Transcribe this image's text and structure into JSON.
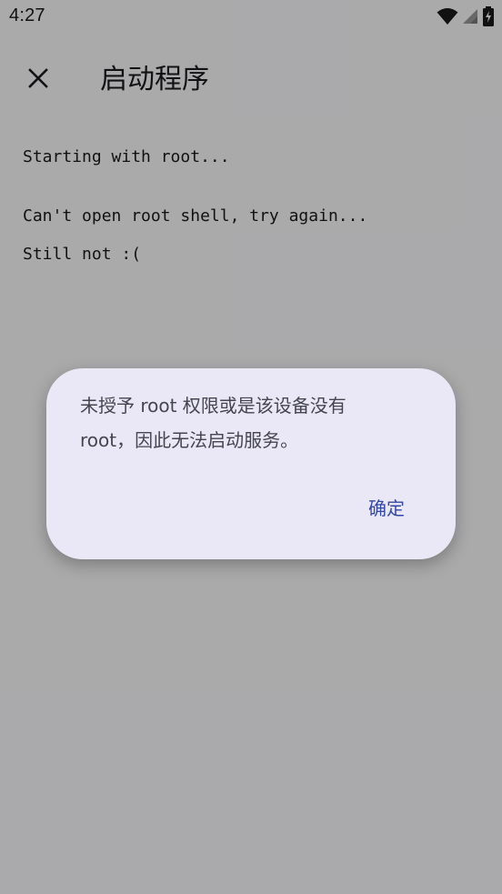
{
  "status_bar": {
    "time": "4:27"
  },
  "app_bar": {
    "title": "启动程序",
    "close_icon": "close-icon"
  },
  "log": {
    "lines": [
      "Starting with root...",
      "Can't open root shell, try again...",
      "Still not :("
    ]
  },
  "dialog": {
    "message_line1": "未授予 root 权限或是该设备没有",
    "message_line2": "root，因此无法启动服务。",
    "confirm_label": "确定"
  },
  "colors": {
    "dialog_background": "#eae8f7",
    "accent": "#3348a6",
    "scrim": "rgba(0,0,0,0.32)"
  }
}
